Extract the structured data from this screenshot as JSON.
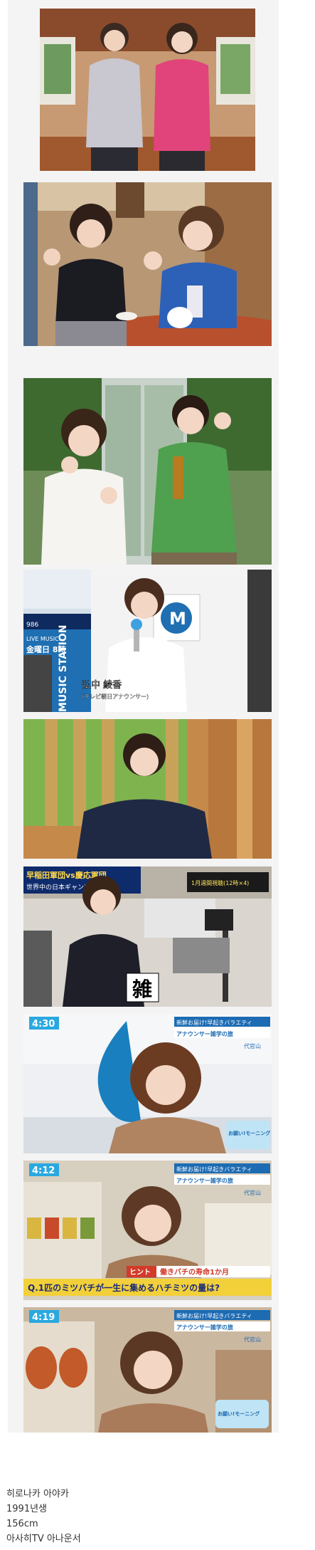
{
  "photos": [
    {
      "id": "p1",
      "scene": "two women posing in studio"
    },
    {
      "id": "p2",
      "scene": "two women waving at table with teapot"
    },
    {
      "id": "p3",
      "scene": "two women waving near window"
    },
    {
      "id": "p4",
      "scene": "announcer holding microphone"
    },
    {
      "id": "p5",
      "scene": "announcer in green studio"
    },
    {
      "id": "p6",
      "scene": "announcer with camera equipment"
    },
    {
      "id": "p7",
      "scene": "announcer reacting in shop"
    },
    {
      "id": "p8",
      "scene": "announcer in shop with honey quiz"
    },
    {
      "id": "p9",
      "scene": "announcer surprised in shop"
    }
  ],
  "overlays": {
    "p4_screen_tv_program": "LIVE MUSIC!",
    "p4_screen_day": "金曜日 8時",
    "p4_screen_show": "MUSIC STATION",
    "p4_screen_prefix": "986",
    "p4_name": "弘中 綾香",
    "p4_name_sub": "(テレビ朝日アナウンサー)",
    "p6_title": "早稲田軍団vs慶応軍団",
    "p6_sub": "世界中の日本ギャンブル",
    "p6_right_banner": "1月週間視聴(12時×4)",
    "p6_big_char": "雑",
    "p7_clock": "4:30",
    "p7_banner1": "新鮮お届け!早起きバラエティ",
    "p7_banner2": "アナウンサー雑学の旅",
    "p7_place": "代官山",
    "p7_logo": "お願い!モーニング",
    "p8_clock": "4:12",
    "p8_banner1": "新鮮お届け!早起きバラエティ",
    "p8_banner2": "アナウンサー雑学の旅",
    "p8_place": "代官山",
    "p8_hint_label": "ヒント",
    "p8_hint_text": "働きバチの寿命1か月",
    "p8_question": "Q.1匹のミツバチが一生に集めるハチミツの量は?",
    "p9_clock": "4:19",
    "p9_banner1": "新鮮お届け!早起きバラエティ",
    "p9_banner2": "アナウンサー雑学の旅",
    "p9_place": "代官山",
    "p9_logo": "お願い!モーニング"
  },
  "caption": {
    "line1": "히로나카 아야카",
    "line2": "1991년생",
    "line3": "156cm",
    "line4": "아사히TV 아나운서"
  }
}
